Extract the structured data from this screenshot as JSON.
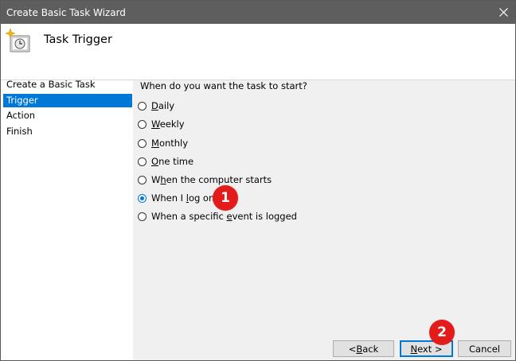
{
  "window": {
    "title": "Create Basic Task Wizard"
  },
  "header": {
    "title": "Task Trigger",
    "icon": "task-scheduler-clock-icon"
  },
  "steps": [
    "Create a Basic Task",
    "Trigger",
    "Action",
    "Finish"
  ],
  "active_step": "Trigger",
  "question": "When do you want the task to start?",
  "options": [
    {
      "before": "",
      "accel": "D",
      "after": "aily",
      "checked": false
    },
    {
      "before": "",
      "accel": "W",
      "after": "eekly",
      "checked": false
    },
    {
      "before": "",
      "accel": "M",
      "after": "onthly",
      "checked": false
    },
    {
      "before": "",
      "accel": "O",
      "after": "ne time",
      "checked": false
    },
    {
      "before": "W",
      "accel": "h",
      "after": "en the computer starts",
      "checked": false
    },
    {
      "before": "When I ",
      "accel": "l",
      "after": "og on",
      "checked": true
    },
    {
      "before": "When a specific ",
      "accel": "e",
      "after": "vent is logged",
      "checked": false
    }
  ],
  "callouts": [
    "1",
    "2"
  ],
  "buttons": {
    "back": {
      "prefix": "< ",
      "accel": "B",
      "rest": "ack"
    },
    "next": {
      "accel": "N",
      "rest": "ext >"
    },
    "cancel": "Cancel"
  },
  "colors": {
    "selection": "#0078d7",
    "titlebar": "#5e5e5e",
    "callout": "#e41b1b"
  }
}
